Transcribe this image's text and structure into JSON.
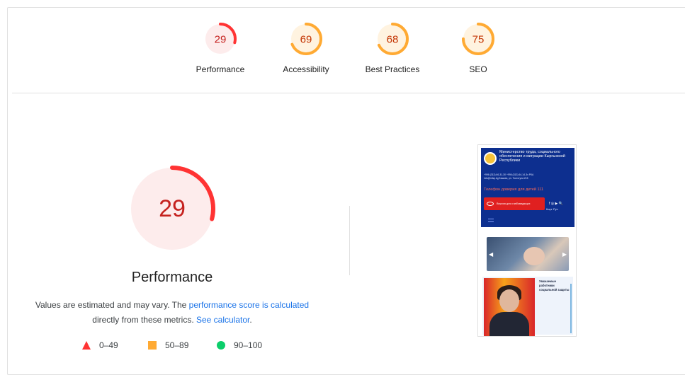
{
  "header_cut": "",
  "categories": [
    {
      "id": "performance",
      "label": "Performance",
      "score": "29",
      "fraction": 0.29,
      "status": "fail",
      "color": "#ff3333",
      "bg": "#fdecec",
      "text_color": "#c5221f"
    },
    {
      "id": "accessibility",
      "label": "Accessibility",
      "score": "69",
      "fraction": 0.69,
      "status": "average",
      "color": "#ffaa33",
      "bg": "#fff3e0",
      "text_color": "#c33300"
    },
    {
      "id": "best-practices",
      "label": "Best Practices",
      "score": "68",
      "fraction": 0.68,
      "status": "average",
      "color": "#ffaa33",
      "bg": "#fff3e0",
      "text_color": "#c33300"
    },
    {
      "id": "seo",
      "label": "SEO",
      "score": "75",
      "fraction": 0.75,
      "status": "average",
      "color": "#ffaa33",
      "bg": "#fff3e0",
      "text_color": "#c33300"
    }
  ],
  "main": {
    "score": "29",
    "fraction": 0.29,
    "title": "Performance",
    "desc_prefix": "Values are estimated and may vary. The ",
    "desc_link": "performance score is calculated",
    "desc_mid": " directly from these metrics. ",
    "desc_link2": "See calculator",
    "desc_suffix": "."
  },
  "legend": [
    {
      "shape": "triangle",
      "range": "0–49",
      "color": "#ff3333"
    },
    {
      "shape": "square",
      "range": "50–89",
      "color": "#ffaa33"
    },
    {
      "shape": "circle",
      "range": "90–100",
      "color": "#0cce6b"
    }
  ],
  "screenshot": {
    "site_title": "Министерство труда, социального обеспечения и миграции Кыргызской Республики",
    "contacts_1": "+996 (312) 66-31-30   +996 (312) 64-14-3x   РКА",
    "contacts_2": "info@mlsp.kg   Бишкек, ул. Токтогула 215",
    "hotline": "Телефон доверия для детей 111",
    "blind_version": "Версия для слабовидящих",
    "lang": "Кырг  Рус",
    "news_text": "Уважаемые работники социальной защиты"
  }
}
